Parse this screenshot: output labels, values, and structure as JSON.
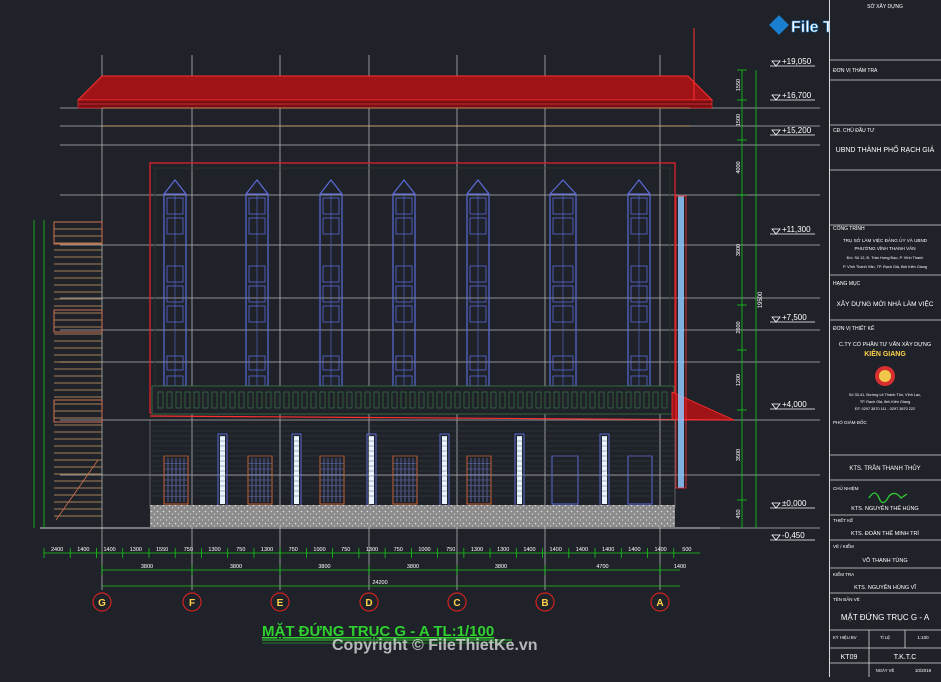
{
  "drawing_title": "MẶT ĐỨNG TRỤC G - A TL:1/100",
  "watermark": {
    "logo_text": "File Thiết Kế.vn",
    "copyright": "Copyright © FileThietKe.vn"
  },
  "elevation_marks": [
    "+19,050",
    "+16,700",
    "+15,200",
    "+11,300",
    "+7,500",
    "+4,000",
    "±0,000",
    "-0,450"
  ],
  "axes": [
    "G",
    "F",
    "E",
    "D",
    "C",
    "B",
    "A"
  ],
  "right_dims": [
    "1550",
    "1500",
    "4000",
    "3800",
    "2600",
    "1200",
    "3500",
    "450"
  ],
  "right_total": "19500",
  "bottom_dims_row1": [
    "2400",
    "1400",
    "1400",
    "1300",
    "1550",
    "750",
    "1300",
    "750",
    "1300",
    "750",
    "1000",
    "750",
    "1300",
    "750",
    "1000",
    "750",
    "1300",
    "1300",
    "1400",
    "1400",
    "1400",
    "1400",
    "1400",
    "1400",
    "500"
  ],
  "bottom_dims_row2": [
    "3800",
    "3800",
    "3800",
    "3800",
    "3800",
    "4700",
    "1400"
  ],
  "bottom_total": "24200",
  "title_block": {
    "header": "SỞ XÂY DỰNG",
    "thamtra_label": "ĐƠN VỊ THẨM TRA",
    "chudautu_label": "CĐ. CHỦ ĐẦU TƯ",
    "chudautu": "UBND THÀNH PHỐ RẠCH GIÁ",
    "congtrinh_label": "CÔNG TRÌNH",
    "congtrinh_lines": [
      "TRỤ SỞ LÀM VIỆC ĐẢNG ỦY VÀ UBND",
      "PHƯỜNG VĨNH THANH VÂN",
      "Đ/c: Số 12, Đ. Trần Hưng Đạo, P. Vĩnh Thanh",
      "P. Vĩnh Thanh Vân, TP. Rạch Giá, tỉnh Kiên Giang"
    ],
    "hangmuc_label": "HẠNG MỤC",
    "hangmuc": "XÂY DỰNG MỚI NHÀ LÀM VIỆC",
    "thietke_label": "ĐƠN VỊ THIẾT KẾ",
    "company_line1": "C.TY CỔ PHẦN TƯ VẤN XÂY DỰNG",
    "company_line2": "KIÊN GIANG",
    "company_addr": [
      "Số 33-41, Đường Lê Thánh Tôn, Vĩnh Lạc,",
      "TP. Rạch Giá, tỉnh Kiên Giang",
      "ĐT: 0297.3870 111 - 0297.3870 222"
    ],
    "giamdoc_label": "PHÓ GIÁM ĐỐC",
    "giamdoc_name": "KTS. TRẦN THANH THỦY",
    "chunhiem_label": "CHỦ NHIỆM",
    "chunhiem_name": "KTS. NGUYỄN THẾ HÙNG",
    "thietke2_label": "THIẾT KẾ",
    "thietke2_name": "KTS. ĐOÀN THẾ MINH TRÍ",
    "vebv_label": "VẼ / KIỂM",
    "vebv_name": "VÕ THANH TÙNG",
    "kiemtra_label": "KIỂM TRA",
    "kiemtra_name": "KTS. NGUYỄN HÙNG VĨ",
    "tenbanve_label": "TÊN BẢN VẼ",
    "tenbanve": "MẶT ĐỨNG TRỤC G - A",
    "kyhieu_label": "KÝ HIỆU BV",
    "kyhieu": "KT09",
    "tyle_label": "TỈ LỆ",
    "tyle": "1:100",
    "phase": "T.K.T.C",
    "ngay_label": "NGÀY VẼ",
    "ngay": "10/2019"
  },
  "colors": {
    "background": "#1f2229",
    "roof": "#a01418",
    "wall_outline": "#d4202a",
    "window": "#5a6bd8",
    "grid": "#d8d8d8",
    "dimension": "#18c818",
    "text_dim": "#ffffff",
    "title_green": "#2fd12f",
    "axis_circle": "#d22222",
    "pillar_light": "#8fc8ff",
    "balustrade": "#3a7a46"
  }
}
